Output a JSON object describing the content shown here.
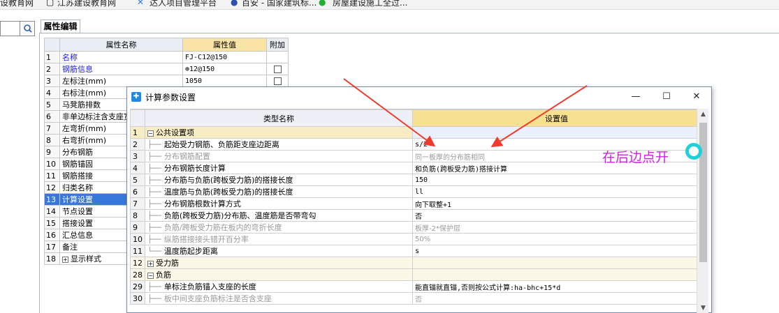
{
  "bookmarks": [
    "设教育网",
    "江苏建设教育网",
    "达人项目管理平台",
    "百安 - 国家建筑标...",
    "房屋建设施工全过..."
  ],
  "search": {
    "placeholder": ""
  },
  "property_panel": {
    "tab": "属性编辑",
    "headers": {
      "name": "属性名称",
      "value": "属性值",
      "extra": "附加"
    },
    "rows": [
      {
        "num": "1",
        "name": "名称",
        "value": "FJ-C12@150",
        "blue": true,
        "checkbox": false
      },
      {
        "num": "2",
        "name": "钢筋信息",
        "value": "⊕12@150",
        "blue": true,
        "checkbox": true
      },
      {
        "num": "3",
        "name": "左标注(mm)",
        "value": "1050",
        "blue": false,
        "checkbox": true
      },
      {
        "num": "4",
        "name": "右标注(mm)",
        "value": "",
        "blue": false,
        "checkbox": false
      },
      {
        "num": "5",
        "name": "马凳筋排数",
        "value": "",
        "blue": false,
        "checkbox": false
      },
      {
        "num": "6",
        "name": "非单边标注含支座宽",
        "value": "",
        "blue": false,
        "checkbox": false
      },
      {
        "num": "7",
        "name": "左弯折(mm)",
        "value": "",
        "blue": false,
        "checkbox": false
      },
      {
        "num": "8",
        "name": "右弯折(mm)",
        "value": "",
        "blue": false,
        "checkbox": false
      },
      {
        "num": "9",
        "name": "分布钢筋",
        "value": "",
        "blue": false,
        "checkbox": false
      },
      {
        "num": "10",
        "name": "钢筋锚固",
        "value": "",
        "blue": false,
        "checkbox": false
      },
      {
        "num": "11",
        "name": "钢筋搭接",
        "value": "",
        "blue": false,
        "checkbox": false
      },
      {
        "num": "12",
        "name": "归类名称",
        "value": "",
        "blue": false,
        "checkbox": false
      },
      {
        "num": "13",
        "name": "计算设置",
        "value": "",
        "blue": false,
        "checkbox": false,
        "selected": true
      },
      {
        "num": "14",
        "name": "节点设置",
        "value": "",
        "blue": false,
        "checkbox": false
      },
      {
        "num": "15",
        "name": "搭接设置",
        "value": "",
        "blue": false,
        "checkbox": false
      },
      {
        "num": "16",
        "name": "汇总信息",
        "value": "",
        "blue": false,
        "checkbox": false
      },
      {
        "num": "17",
        "name": "备注",
        "value": "",
        "blue": false,
        "checkbox": false
      },
      {
        "num": "18",
        "name": "显示样式",
        "value": "",
        "blue": false,
        "checkbox": false,
        "expandable": true
      }
    ]
  },
  "dialog": {
    "title": "计算参数设置",
    "headers": {
      "name": "类型名称",
      "value": "设置值"
    },
    "rows": [
      {
        "num": "1",
        "name": "公共设置项",
        "value": "",
        "group": true,
        "expander": "−",
        "first": true
      },
      {
        "num": "2",
        "name": "起始受力钢筋、负筋距支座边距离",
        "value": "s/2"
      },
      {
        "num": "3",
        "name": "分布钢筋配置",
        "value": "同一板厚的分布筋相同",
        "gray": true
      },
      {
        "num": "4",
        "name": "分布钢筋长度计算",
        "value": "和负筋(跨板受力筋)搭接计算"
      },
      {
        "num": "5",
        "name": "分布筋与负筋(跨板受力筋)的搭接长度",
        "value": "150"
      },
      {
        "num": "6",
        "name": "温度筋与负筋(跨板受力筋)的搭接长度",
        "value": "ll"
      },
      {
        "num": "7",
        "name": "分布钢筋根数计算方式",
        "value": "向下取整+1"
      },
      {
        "num": "8",
        "name": "负筋(跨板受力筋)分布筋、温度筋是否带弯勾",
        "value": "否"
      },
      {
        "num": "9",
        "name": "负筋/跨板受力筋在板内的弯折长度",
        "value": "板厚-2*保护层",
        "gray": true
      },
      {
        "num": "10",
        "name": "纵筋搭接接头错开百分率",
        "value": "50%",
        "gray": true
      },
      {
        "num": "11",
        "name": "温度筋起步距离",
        "value": "s",
        "last_in_group": true
      },
      {
        "num": "12",
        "name": "受力筋",
        "value": "",
        "group": true,
        "expander": "+"
      },
      {
        "num": "28",
        "name": "负筋",
        "value": "",
        "group": true,
        "expander": "−"
      },
      {
        "num": "29",
        "name": "单标注负筋锚入支座的长度",
        "value": "能直锚就直锚,否则按公式计算:ha-bhc+15*d"
      },
      {
        "num": "30",
        "name": "板中间支座负筋标注是否含支座",
        "value": "否",
        "gray": true
      }
    ]
  },
  "annotation": {
    "text": "在后边点开",
    "arrow_color": "#f03a2e",
    "circle_color": "#1fd0d8",
    "text_color": "#d51ee6"
  }
}
